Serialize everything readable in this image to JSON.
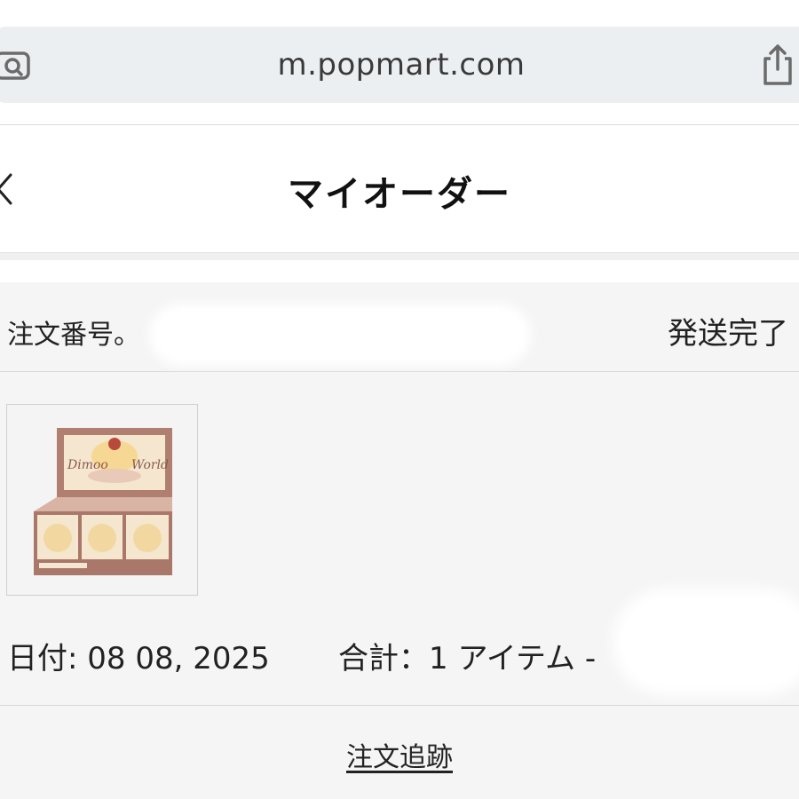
{
  "browser": {
    "url": "m.popmart.com"
  },
  "header": {
    "title": "マイオーダー"
  },
  "order": {
    "number_label": "注文番号。",
    "status": "発送完了",
    "date": "日付: 08 08, 2025",
    "total": "合計：1 アイテム -",
    "track_label": "注文追跡"
  },
  "product_image": {
    "box_text_1": "Dimoo",
    "box_text_2": "World"
  },
  "colors": {
    "urlbar_bg": "#eceff2",
    "card_bg": "#f5f5f5",
    "box_brown": "#a9786b",
    "box_cream": "#f4e6cf"
  }
}
